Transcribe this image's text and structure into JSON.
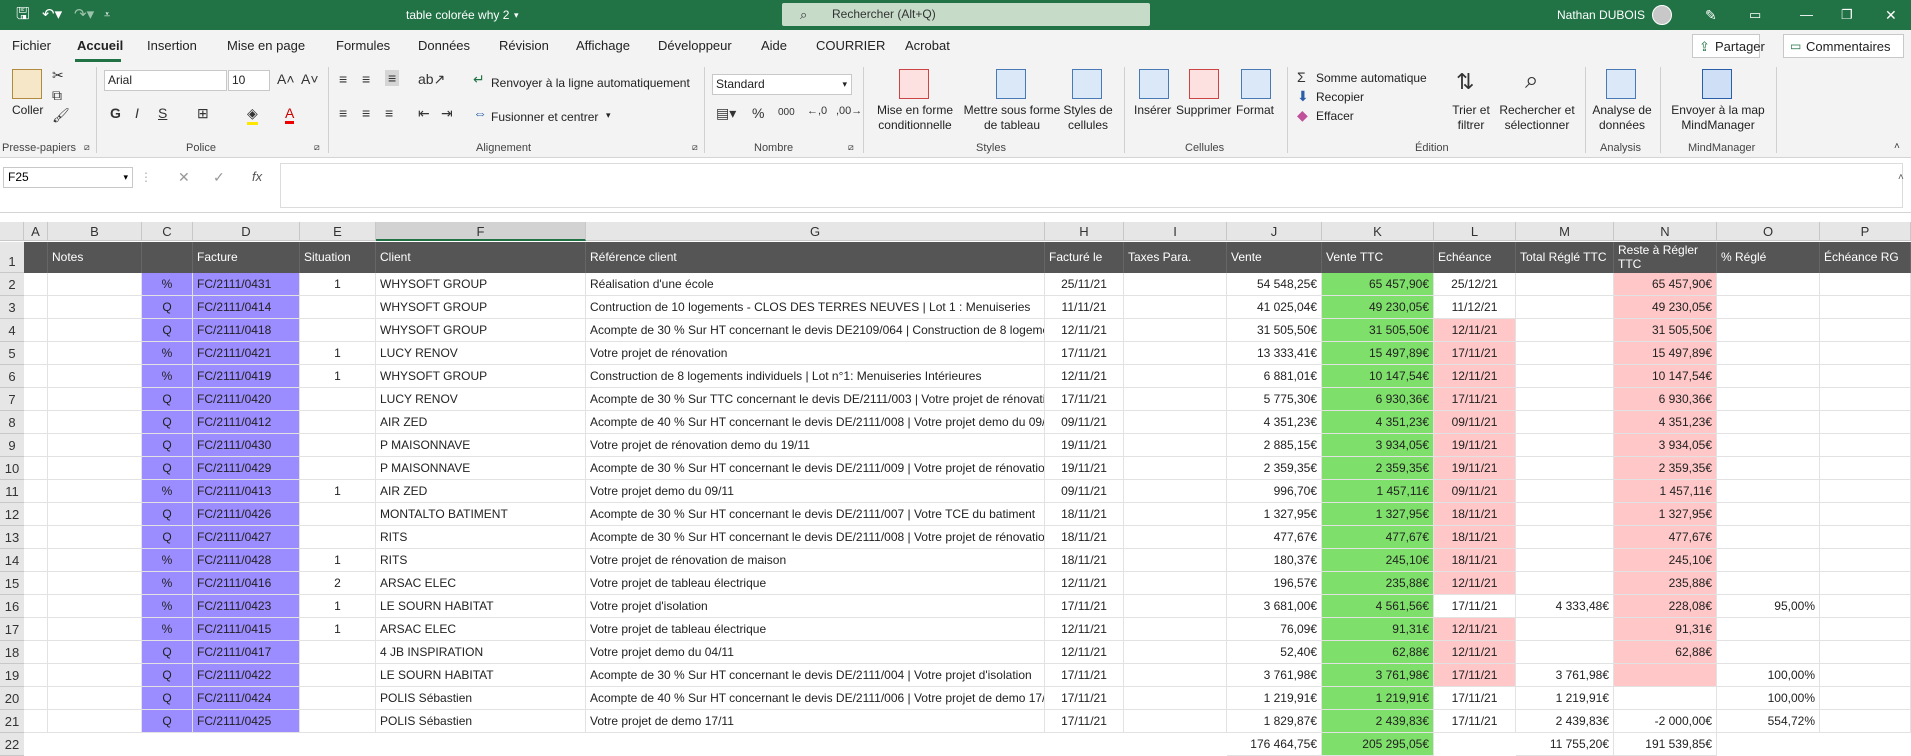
{
  "title": {
    "doc_name": "table colorée why 2",
    "search_placeholder": "Rechercher (Alt+Q)",
    "user_name": "Nathan DUBOIS"
  },
  "menu": [
    "Fichier",
    "Accueil",
    "Insertion",
    "Mise en page",
    "Formules",
    "Données",
    "Révision",
    "Affichage",
    "Développeur",
    "Aide",
    "COURRIER",
    "Acrobat"
  ],
  "menu_right": {
    "share": "Partager",
    "comments": "Commentaires"
  },
  "ribbon": {
    "paste": "Coller",
    "font_name": "Arial",
    "font_size": "10",
    "bold": "G",
    "italic": "I",
    "underline": "S",
    "wrap": "Renvoyer à la ligne automatiquement",
    "merge": "Fusionner et centrer",
    "number_format": "Standard",
    "cond_format": "Mise en forme conditionnelle",
    "table_format": "Mettre sous forme de tableau",
    "cell_styles": "Styles de cellules",
    "insert": "Insérer",
    "delete": "Supprimer",
    "format": "Format",
    "autosum": "Somme automatique",
    "fill": "Recopier",
    "clear": "Effacer",
    "sort": "Trier et filtrer",
    "find": "Rechercher et sélectionner",
    "analyze": "Analyse de données",
    "mindmanager": "Envoyer à la map MindManager",
    "groups": {
      "clipboard": "Presse-papiers",
      "font": "Police",
      "alignment": "Alignement",
      "number": "Nombre",
      "styles": "Styles",
      "cells": "Cellules",
      "editing": "Édition",
      "analysis": "Analysis",
      "mindmanager": "MindManager"
    }
  },
  "name_box": "F25",
  "columns": [
    "A",
    "B",
    "C",
    "D",
    "E",
    "F",
    "G",
    "H",
    "I",
    "J",
    "K",
    "L",
    "M",
    "N",
    "O",
    "P"
  ],
  "headers": [
    "",
    "Notes",
    "",
    "Facture",
    "Situation",
    "Client",
    "Référence client",
    "Facturé le",
    "Taxes Para.",
    "Vente",
    "Vente TTC",
    "Echéance",
    "Total Réglé TTC",
    "Reste à Régler TTC",
    "% Réglé",
    "Échéance RG"
  ],
  "rows": [
    [
      "%",
      "FC/2111/0431",
      "1",
      "WHYSOFT GROUP",
      "Réalisation d'une école",
      "25/11/21",
      "",
      "54 548,25€",
      "65 457,90€",
      "25/12/21",
      "",
      "65 457,90€",
      ""
    ],
    [
      "Q",
      "FC/2111/0414",
      "",
      "WHYSOFT GROUP",
      "Contruction de 10 logements - CLOS DES TERRES NEUVES | Lot 1 : Menuiseries",
      "11/11/21",
      "",
      "41 025,04€",
      "49 230,05€",
      "11/12/21",
      "",
      "49 230,05€",
      ""
    ],
    [
      "Q",
      "FC/2111/0418",
      "",
      "WHYSOFT GROUP",
      "Acompte de 30 % Sur HT concernant le devis DE2109/064 | Construction de 8 logements",
      "12/11/21",
      "",
      "31 505,50€",
      "31 505,50€",
      "12/11/21",
      "",
      "31 505,50€",
      ""
    ],
    [
      "%",
      "FC/2111/0421",
      "1",
      "LUCY RENOV",
      "Votre projet de rénovation",
      "17/11/21",
      "",
      "13 333,41€",
      "15 497,89€",
      "17/11/21",
      "",
      "15 497,89€",
      ""
    ],
    [
      "%",
      "FC/2111/0419",
      "1",
      "WHYSOFT GROUP",
      "Construction de 8 logements individuels | Lot n°1: Menuiseries Intérieures",
      "12/11/21",
      "",
      "6 881,01€",
      "10 147,54€",
      "12/11/21",
      "",
      "10 147,54€",
      ""
    ],
    [
      "Q",
      "FC/2111/0420",
      "",
      "LUCY RENOV",
      "Acompte de 30 % Sur TTC concernant le devis DE/2111/003 | Votre projet de rénovation",
      "17/11/21",
      "",
      "5 775,30€",
      "6 930,36€",
      "17/11/21",
      "",
      "6 930,36€",
      ""
    ],
    [
      "Q",
      "FC/2111/0412",
      "",
      "AIR ZED",
      "Acompte de 40 % Sur HT concernant le devis DE/2111/008 | Votre projet demo du 09/11",
      "09/11/21",
      "",
      "4 351,23€",
      "4 351,23€",
      "09/11/21",
      "",
      "4 351,23€",
      ""
    ],
    [
      "Q",
      "FC/2111/0430",
      "",
      "P MAISONNAVE",
      "Votre projet de rénovation demo du 19/11",
      "19/11/21",
      "",
      "2 885,15€",
      "3 934,05€",
      "19/11/21",
      "",
      "3 934,05€",
      ""
    ],
    [
      "Q",
      "FC/2111/0429",
      "",
      "P MAISONNAVE",
      "Acompte de 30 % Sur HT concernant le devis DE/2111/009 | Votre projet de rénovation",
      "19/11/21",
      "",
      "2 359,35€",
      "2 359,35€",
      "19/11/21",
      "",
      "2 359,35€",
      ""
    ],
    [
      "%",
      "FC/2111/0413",
      "1",
      "AIR ZED",
      "Votre projet demo du 09/11",
      "09/11/21",
      "",
      "996,70€",
      "1 457,11€",
      "09/11/21",
      "",
      "1 457,11€",
      ""
    ],
    [
      "Q",
      "FC/2111/0426",
      "",
      "MONTALTO BATIMENT",
      "Acompte de 30 % Sur HT concernant le devis DE/2111/007 | Votre TCE du batiment",
      "18/11/21",
      "",
      "1 327,95€",
      "1 327,95€",
      "18/11/21",
      "",
      "1 327,95€",
      ""
    ],
    [
      "Q",
      "FC/2111/0427",
      "",
      "RITS",
      "Acompte de 30 % Sur HT concernant le devis DE/2111/008 | Votre projet de rénovation",
      "18/11/21",
      "",
      "477,67€",
      "477,67€",
      "18/11/21",
      "",
      "477,67€",
      ""
    ],
    [
      "%",
      "FC/2111/0428",
      "1",
      "RITS",
      "Votre projet de rénovation de maison",
      "18/11/21",
      "",
      "180,37€",
      "245,10€",
      "18/11/21",
      "",
      "245,10€",
      ""
    ],
    [
      "%",
      "FC/2111/0416",
      "2",
      "ARSAC ELEC",
      "Votre projet de tableau électrique",
      "12/11/21",
      "",
      "196,57€",
      "235,88€",
      "12/11/21",
      "",
      "235,88€",
      ""
    ],
    [
      "%",
      "FC/2111/0423",
      "1",
      "LE SOURN HABITAT",
      "Votre projet d'isolation",
      "17/11/21",
      "",
      "3 681,00€",
      "4 561,56€",
      "17/11/21",
      "4 333,48€",
      "228,08€",
      "95,00%"
    ],
    [
      "%",
      "FC/2111/0415",
      "1",
      "ARSAC ELEC",
      "Votre projet de tableau électrique",
      "12/11/21",
      "",
      "76,09€",
      "91,31€",
      "12/11/21",
      "",
      "91,31€",
      ""
    ],
    [
      "Q",
      "FC/2111/0417",
      "",
      "4 JB INSPIRATION",
      "Votre projet demo du 04/11",
      "12/11/21",
      "",
      "52,40€",
      "62,88€",
      "12/11/21",
      "",
      "62,88€",
      ""
    ],
    [
      "Q",
      "FC/2111/0422",
      "",
      "LE SOURN HABITAT",
      "Acompte de 30 % Sur HT concernant le devis DE/2111/004 | Votre projet d'isolation",
      "17/11/21",
      "",
      "3 761,98€",
      "3 761,98€",
      "17/11/21",
      "3 761,98€",
      "",
      "100,00%"
    ],
    [
      "Q",
      "FC/2111/0424",
      "",
      "POLIS Sébastien",
      "Acompte de 40 % Sur HT concernant le devis DE/2111/006 | Votre projet de demo 17/11",
      "17/11/21",
      "",
      "1 219,91€",
      "1 219,91€",
      "17/11/21",
      "1 219,91€",
      "",
      "100,00%"
    ],
    [
      "Q",
      "FC/2111/0425",
      "",
      "POLIS Sébastien",
      "Votre projet de demo 17/11",
      "17/11/21",
      "",
      "1 829,87€",
      "2 439,83€",
      "17/11/21",
      "2 439,83€",
      "-2 000,00€",
      "554,72%"
    ]
  ],
  "totals": {
    "vente": "176 464,75€",
    "vente_ttc": "205 295,05€",
    "total_regle": "11 755,20€",
    "reste": "191 539,85€"
  },
  "highlights": {
    "green": "#7ee06a",
    "pink": "#ffc7c7",
    "purple": "#9b8cff",
    "header": "#555555",
    "titlebar": "#217346"
  }
}
